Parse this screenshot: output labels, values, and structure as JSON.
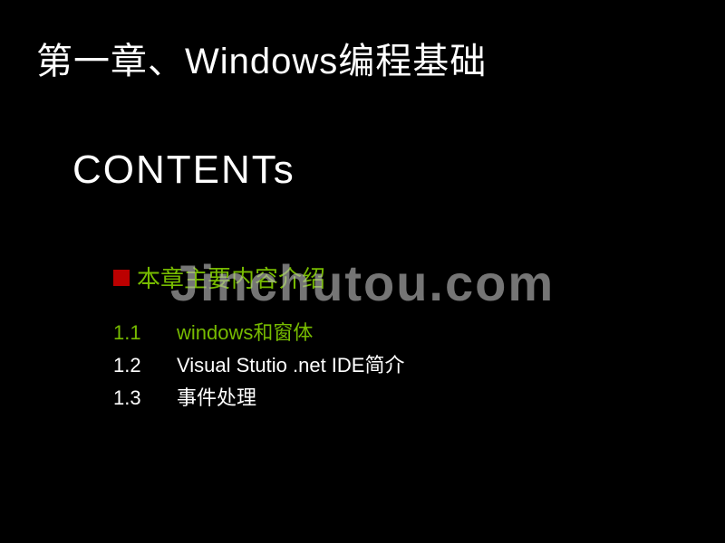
{
  "slide": {
    "chapter_title": "第一章、Windows编程基础",
    "contents_label": "CONTENTs",
    "intro_text": "本章主要内容介绍",
    "toc": [
      {
        "number": "1.1",
        "title": "windows和窗体",
        "highlighted": true
      },
      {
        "number": "1.2",
        "title": "Visual Stutio .net IDE简介",
        "highlighted": false
      },
      {
        "number": "1.3",
        "title": "事件处理",
        "highlighted": false
      }
    ]
  },
  "watermark": "Jinchutou.com"
}
